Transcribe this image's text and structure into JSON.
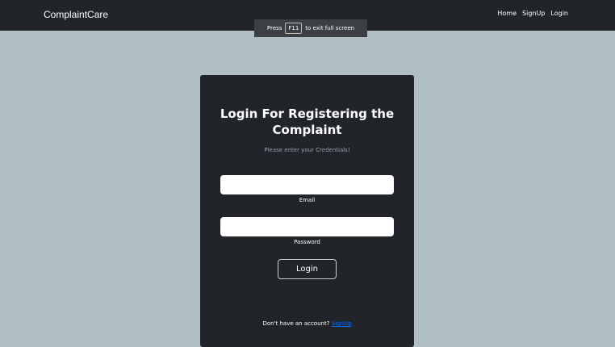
{
  "navbar": {
    "brand": "ComplaintCare",
    "links": [
      "Home",
      "SignUp",
      "Login"
    ]
  },
  "fullscreen_notice": {
    "prefix": "Press",
    "key": "F11",
    "suffix": "to exit full screen"
  },
  "login_card": {
    "title": "Login For Registering the Complaint",
    "subtitle": "Please enter your Credentials!",
    "email_label": "Email",
    "email_value": "",
    "password_label": "Password",
    "password_value": "",
    "login_button": "Login",
    "signup_prompt": "Don't have an account?",
    "signup_link": "SignUp"
  },
  "colors": {
    "page_background": "#b0bec5",
    "navbar_background": "#212529",
    "card_background": "#212529",
    "link_color": "#0d6efd"
  }
}
